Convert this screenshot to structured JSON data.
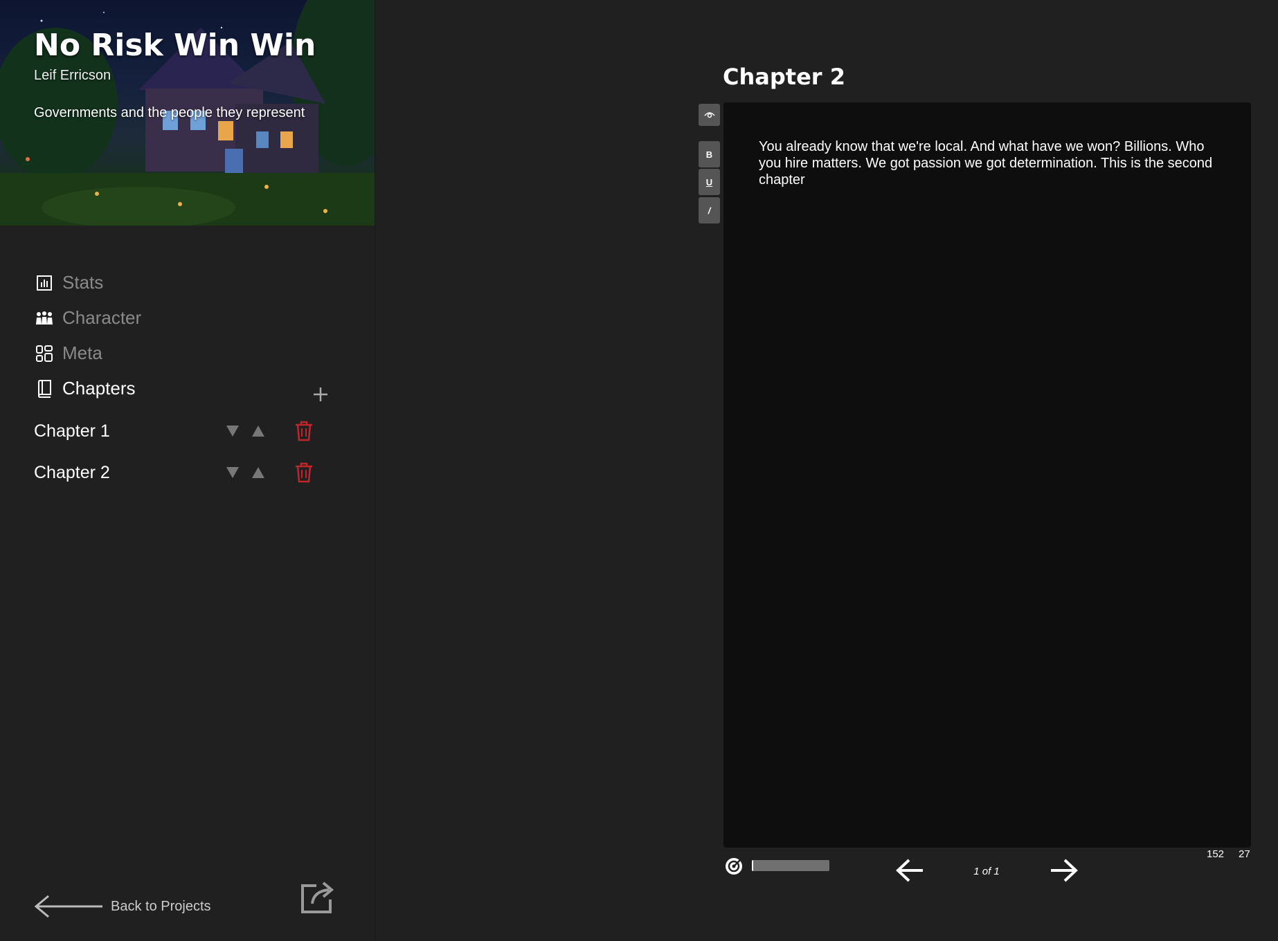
{
  "project": {
    "title": "No Risk Win Win",
    "author": "Leif Erricson",
    "description": "Governments and the people they represent"
  },
  "nav": [
    {
      "label": "Stats",
      "icon": "stats-icon",
      "active": false
    },
    {
      "label": "Character",
      "icon": "character-icon",
      "active": false
    },
    {
      "label": "Meta",
      "icon": "meta-icon",
      "active": false
    },
    {
      "label": "Chapters",
      "icon": "book-icon",
      "active": true
    }
  ],
  "chapters": [
    {
      "name": "Chapter 1"
    },
    {
      "name": "Chapter 2"
    }
  ],
  "back_label": "Back to Projects",
  "editor": {
    "chapter_title": "Chapter 2",
    "toolbar": {
      "view_icon": "eye-icon",
      "bold": "B",
      "underline": "U",
      "italic": "/"
    },
    "content": "You already know that we're local. And what have we won? Billions. Who you hire matters. We got passion we got determination. This is the second chapter",
    "count_a": "152",
    "count_b": "27",
    "page_indicator": "1 of 1",
    "progress_fraction": 0.02
  },
  "colors": {
    "background": "#202020",
    "editor_background": "#0e0e0e",
    "delete_red": "#c0252a",
    "inactive_nav": "#8a8a8a"
  }
}
